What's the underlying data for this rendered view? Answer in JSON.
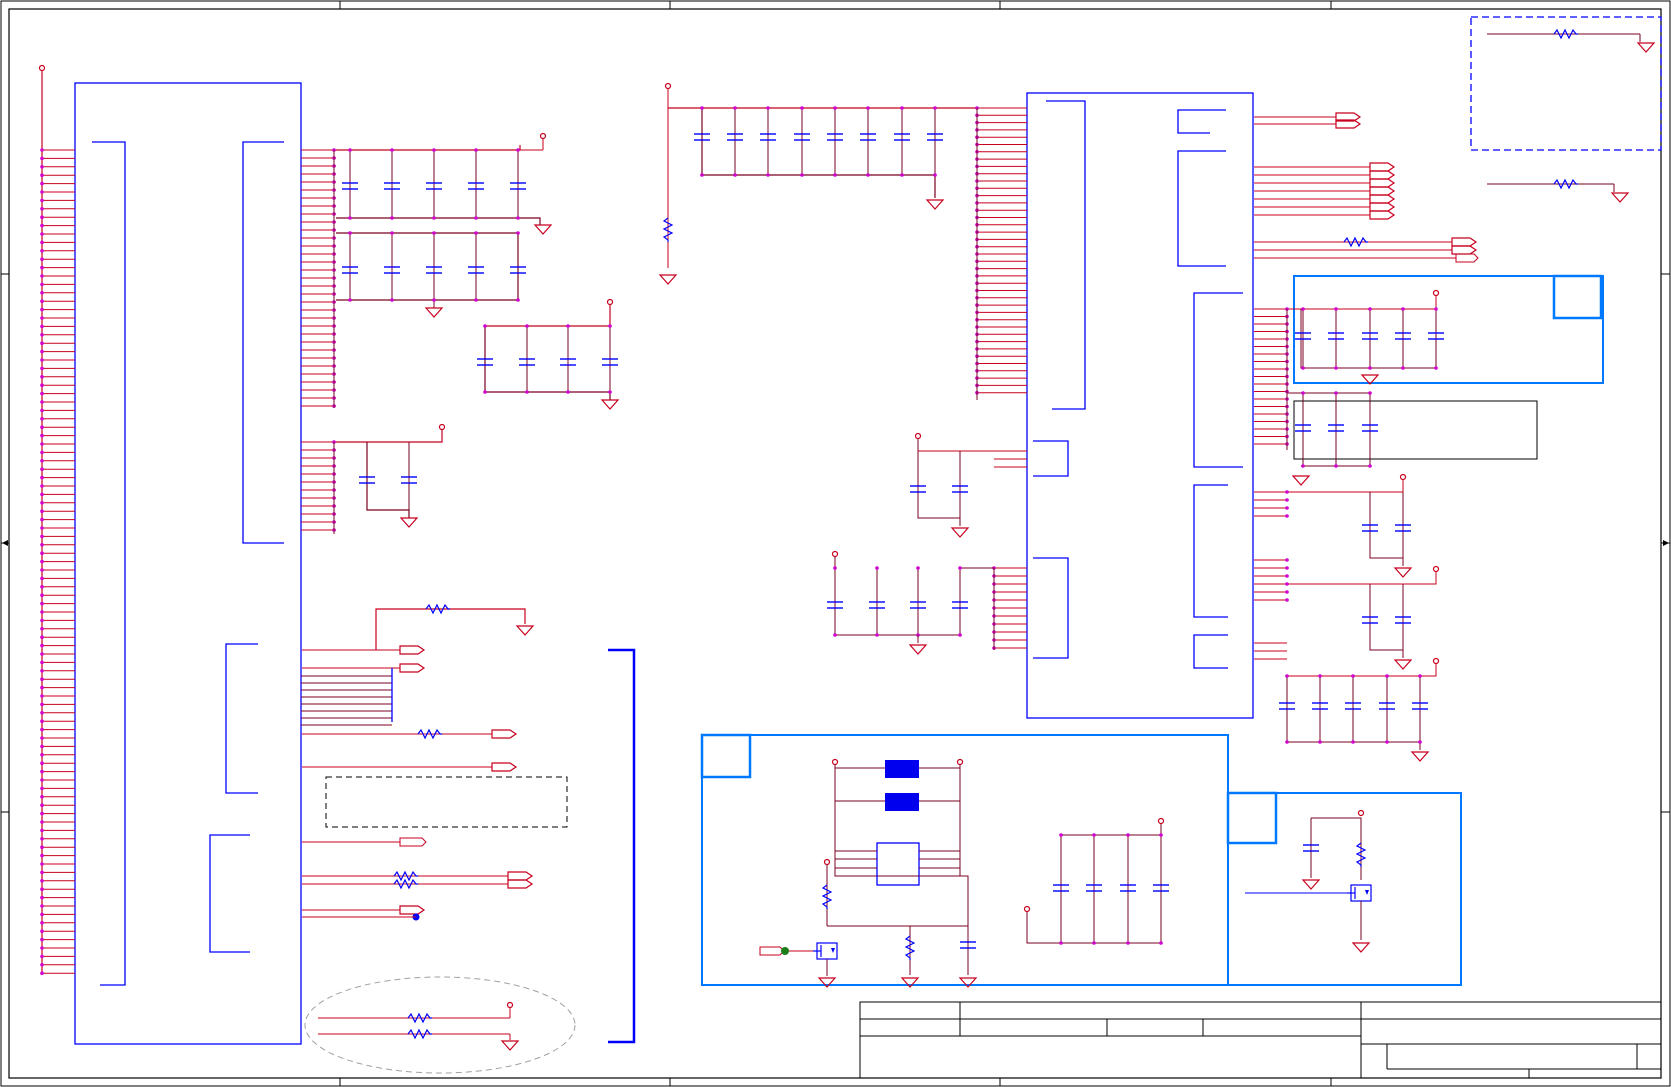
{
  "colors": {
    "frame": "#000000",
    "wire": "#c8001e",
    "net": "#7a0020",
    "block": "#0000ff",
    "highlight_block": "#0078ff",
    "node": "#d000d0",
    "fill_chip": "#0000ee",
    "junction_green": "#1a7f1a",
    "junction_blue": "#0000ff",
    "dashed_ellipse": "#a0a0a0"
  },
  "icons": {
    "resistor": "resistor-icon",
    "capacitor": "capacitor-icon",
    "ground": "ground-icon",
    "power_pin": "power-pin-icon",
    "port": "port-arrow-icon",
    "mosfet": "mosfet-icon"
  },
  "title_block": {
    "sheet_title": "",
    "doc_number": "",
    "rev": ""
  }
}
